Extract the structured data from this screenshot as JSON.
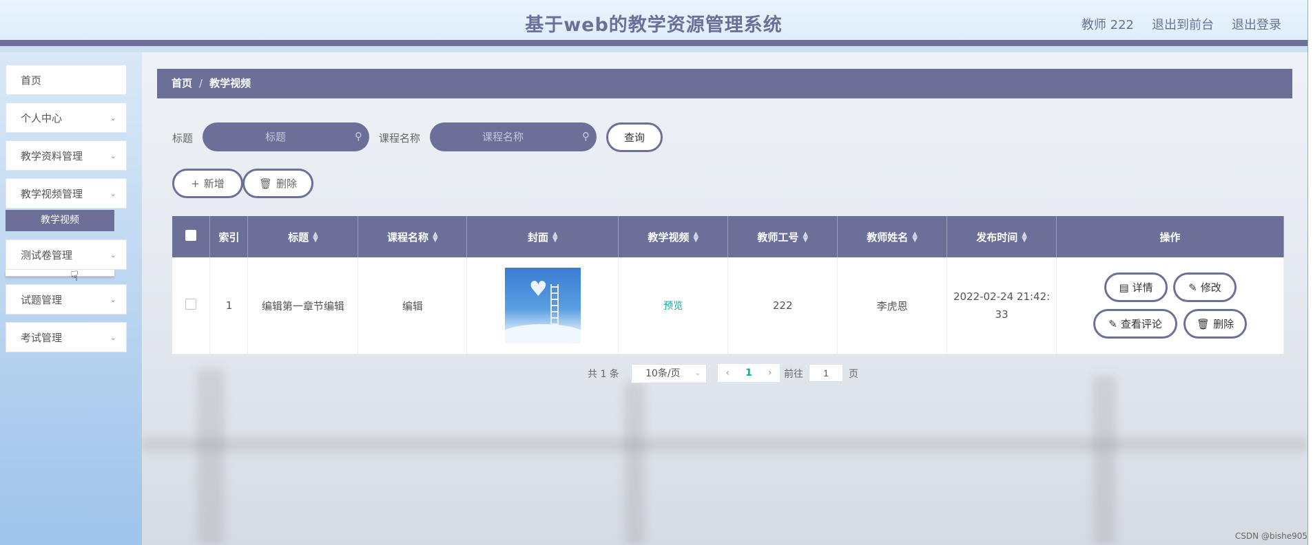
{
  "header": {
    "title": "基于web的教学资源管理系统",
    "user": "教师 222",
    "front_link": "退出到前台",
    "logout": "退出登录"
  },
  "sidebar": {
    "items": [
      {
        "label": "首页"
      },
      {
        "label": "个人中心"
      },
      {
        "label": "教学资料管理"
      },
      {
        "label": "教学视频管理"
      },
      {
        "label": "测试卷管理"
      },
      {
        "label": "试题管理"
      },
      {
        "label": "考试管理"
      }
    ],
    "sub_item": "教学视频"
  },
  "breadcrumb": {
    "home": "首页",
    "separator": "/",
    "current": "教学视频"
  },
  "search": {
    "title_label": "标题",
    "title_placeholder": "标题",
    "course_label": "课程名称",
    "course_placeholder": "课程名称",
    "query_button": "查询"
  },
  "actions": {
    "add": "新增",
    "delete": "删除"
  },
  "table": {
    "columns": [
      "索引",
      "标题",
      "课程名称",
      "封面",
      "教学视频",
      "教师工号",
      "教师姓名",
      "发布时间",
      "操作"
    ],
    "rows": [
      {
        "index": "1",
        "title": "编辑第一章节编辑",
        "course": "编辑",
        "video": "预览",
        "teacher_id": "222",
        "teacher_name": "李虎恩",
        "publish_time_1": "2022-02-24 21:42:",
        "publish_time_2": "33",
        "ops": {
          "detail": "详情",
          "edit": "修改",
          "comments": "查看评论",
          "delete": "删除"
        }
      }
    ]
  },
  "pagination": {
    "total": "共 1 条",
    "page_size": "10条/页",
    "current_page": "1",
    "goto_label": "前往",
    "goto_value": "1",
    "page_suffix": "页"
  },
  "watermark": "CSDN @bishe905",
  "colors": {
    "accent": "#6c7099",
    "link": "#18a999"
  },
  "icons": [
    "search-icon",
    "plus-icon",
    "trash-icon",
    "document-icon",
    "edit-icon",
    "chevron-down-icon",
    "chevron-left-icon",
    "chevron-right-icon",
    "sort-icon",
    "pointer-cursor-icon"
  ]
}
